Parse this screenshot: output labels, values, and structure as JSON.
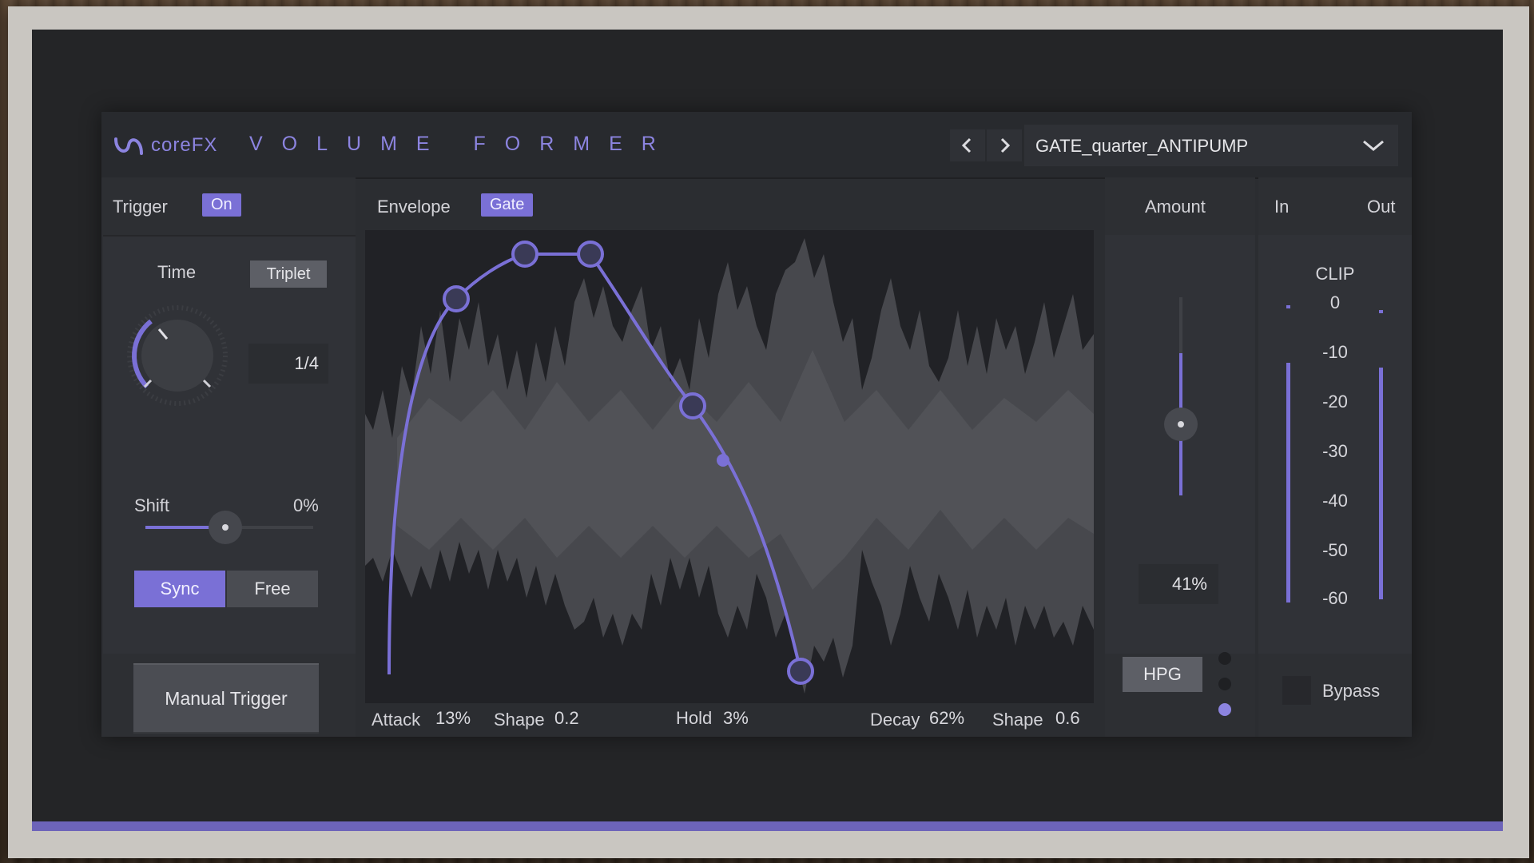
{
  "header": {
    "brand": "coreFX",
    "title": "VOLUME FORMER",
    "prev_icon": "‹",
    "next_icon": "›",
    "preset": "GATE_quarter_ANTIPUMP",
    "dropdown_icon": "⌄"
  },
  "trigger": {
    "label": "Trigger",
    "state": "On",
    "time_label": "Time",
    "triplet": "Triplet",
    "time_value": "1/4",
    "shift_label": "Shift",
    "shift_value": "0%",
    "sync": "Sync",
    "free": "Free",
    "manual": "Manual Trigger"
  },
  "envelope": {
    "label": "Envelope",
    "mode": "Gate",
    "attack_label": "Attack",
    "attack_value": "13%",
    "shape1_label": "Shape",
    "shape1_value": "0.2",
    "hold_label": "Hold",
    "hold_value": "3%",
    "decay_label": "Decay",
    "decay_value": "62%",
    "shape2_label": "Shape",
    "shape2_value": "0.6"
  },
  "amount": {
    "label": "Amount",
    "value": "41%",
    "fraction": 0.41,
    "hpg": "HPG"
  },
  "meters": {
    "in": "In",
    "out": "Out",
    "clip": "CLIP",
    "scale": [
      "0",
      "-10",
      "-20",
      "-30",
      "-40",
      "-50",
      "-60"
    ],
    "bypass": "Bypass"
  },
  "colors": {
    "accent": "#7a70d6",
    "panel": "#2b2d31"
  }
}
